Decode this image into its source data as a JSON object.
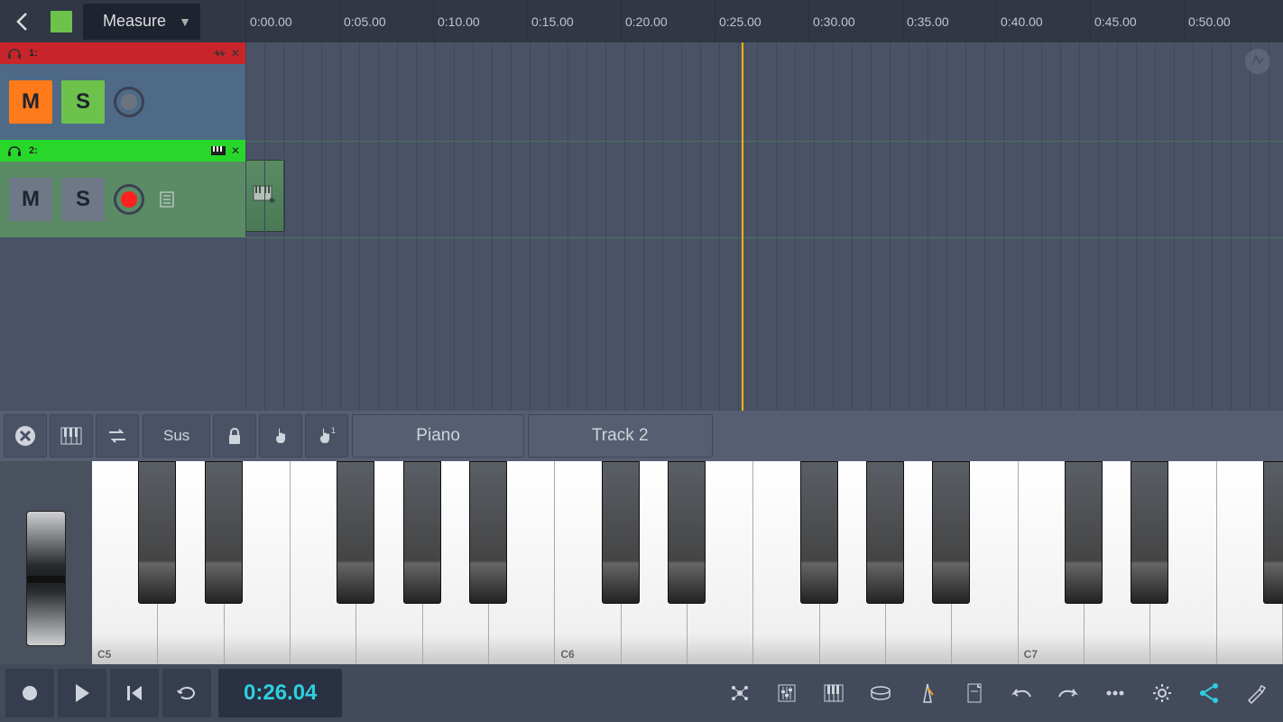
{
  "topbar": {
    "mode_label": "Measure"
  },
  "ruler": {
    "ticks": [
      "0:00.00",
      "0:05.00",
      "0:10.00",
      "0:15.00",
      "0:20.00",
      "0:25.00",
      "0:30.00",
      "0:35.00",
      "0:40.00",
      "0:45.00",
      "0:50.00"
    ]
  },
  "tracks": [
    {
      "num": "1:",
      "mute": "M",
      "solo": "S",
      "color": "red",
      "armed": false
    },
    {
      "num": "2:",
      "mute": "M",
      "solo": "S",
      "color": "green",
      "armed": true
    }
  ],
  "pianobar": {
    "sustain": "Sus",
    "instrument": "Piano",
    "track_label": "Track 2"
  },
  "keyboard": {
    "labels": [
      "C5",
      "C6",
      "C7"
    ]
  },
  "transport": {
    "time": "0:26.04"
  }
}
